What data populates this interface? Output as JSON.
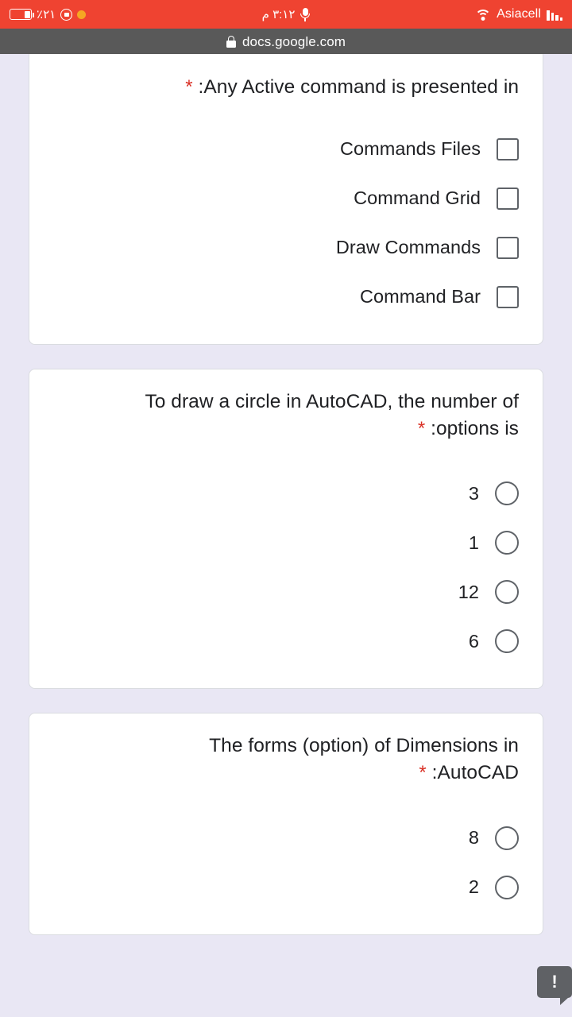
{
  "status_bar": {
    "battery_percent_text": "٪٢١",
    "battery_icon": "battery-icon",
    "rotation_lock_icon": "rotation-lock-icon",
    "notification_dot_icon": "notification-dot-icon",
    "time_text": "٣:١٢ م",
    "mic_icon": "microphone-icon",
    "wifi_icon": "wifi-icon",
    "carrier": "Asiacell",
    "signal_icon": "signal-bars-icon",
    "background_color": "#ef4331"
  },
  "browser": {
    "lock_icon": "lock-icon",
    "url": "docs.google.com",
    "background_color": "#595959"
  },
  "form": {
    "background_color": "#e9e7f4",
    "required_marker": "*",
    "required_color": "#d93025",
    "questions": [
      {
        "id": "q1",
        "title": ":Any Active command is presented in",
        "required": true,
        "input_type": "checkbox",
        "options": [
          {
            "label": "Commands Files",
            "selected": false
          },
          {
            "label": "Command Grid",
            "selected": false
          },
          {
            "label": "Draw Commands",
            "selected": false
          },
          {
            "label": "Command Bar",
            "selected": false
          }
        ]
      },
      {
        "id": "q2",
        "title": "To draw a circle in AutoCAD, the number of options is:",
        "title_line1": "To draw a circle in AutoCAD, the number of",
        "title_line2": ":options is",
        "required": true,
        "input_type": "radio",
        "options": [
          {
            "label": "3",
            "selected": false
          },
          {
            "label": "1",
            "selected": false
          },
          {
            "label": "12",
            "selected": false
          },
          {
            "label": "6",
            "selected": false
          }
        ]
      },
      {
        "id": "q3",
        "title": "The forms (option) of Dimensions in AutoCAD:",
        "title_line1": "The forms (option) of Dimensions in",
        "title_line2": ":AutoCAD",
        "required": true,
        "input_type": "radio",
        "options": [
          {
            "label": "8",
            "selected": false
          },
          {
            "label": "2",
            "selected": false
          }
        ]
      }
    ]
  },
  "info_badge": {
    "icon": "exclamation-icon",
    "glyph": "!",
    "color": "#5f6165"
  }
}
